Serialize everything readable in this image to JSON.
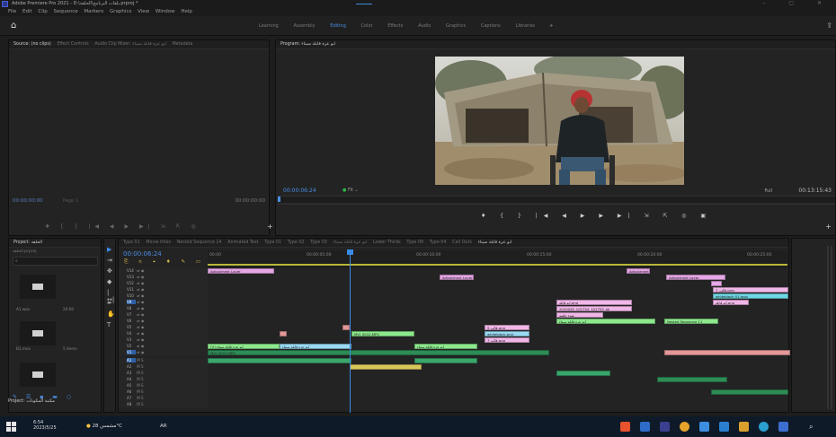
{
  "window": {
    "title": "Adobe Premiere Pro 2021 - D:\\بلقات البرنامج\\الحلقة.prproj *",
    "controls": "– ▢ ✕"
  },
  "menu": [
    "File",
    "Edit",
    "Clip",
    "Sequence",
    "Markers",
    "Graphics",
    "View",
    "Window",
    "Help"
  ],
  "workspaces": {
    "items": [
      "Learning",
      "Assembly",
      "Editing",
      "Color",
      "Effects",
      "Audio",
      "Graphics",
      "Captions",
      "Libraries"
    ],
    "active": "Editing",
    "more": "»"
  },
  "source_panel": {
    "tabs": [
      "Source: (no clips)",
      "Effect Controls",
      "Audio Clip Mixer: ابو عزة قابلة سيناء",
      "Metadata"
    ],
    "timecode_in": "00:00:00:00",
    "page": "Page 1",
    "timecode_out": "00:00:00:00"
  },
  "program_panel": {
    "tab": "Program: ابو عزة قابلة سيناء",
    "timecode": "00:00:06:24",
    "fit": "Fit",
    "quality": "Full",
    "duration": "00:13:15:43"
  },
  "project_panel": {
    "tab": "Project: الحلقة",
    "search_placeholder": "",
    "file": "الحلقة.prproj",
    "items": [
      {
        "name": "A1.wav",
        "meta": "24:00"
      },
      {
        "name": "B1.mov",
        "meta": "5 items"
      },
      {
        "name": "",
        "meta": ""
      }
    ],
    "bottom_tab": "Project: مكتبة المكونات"
  },
  "timeline": {
    "tabs": [
      "Type 01",
      "Movie titles",
      "Nested Sequence 14",
      "Animated Text",
      "Type 01",
      "Type 02",
      "Type 03",
      "ابو عزة قابلة سيناء",
      "Lower Thirds",
      "Type 08",
      "Type 04",
      "Call Outs",
      "ابو عزة قابلة سيناء"
    ],
    "active_tab": "ابو عزة قابلة سيناء",
    "timecode": "00:00:06:24",
    "ruler": [
      "00:00",
      "00:00:05:00",
      "00:00:10:00",
      "00:00:15:00",
      "00:00:20:00",
      "00:00:25:00"
    ],
    "video_tracks": [
      "V14",
      "V13",
      "V12",
      "V11",
      "V10",
      "V9",
      "V8",
      "V7",
      "V6",
      "V5",
      "V4",
      "V3",
      "V2",
      "V1"
    ],
    "audio_tracks": [
      "A1",
      "A2",
      "A3",
      "A4",
      "A5",
      "A6",
      "A7",
      "A8"
    ],
    "clips": {
      "adjustment": "Adjustment Layer",
      "lower_third": "ابو عزة قابلة سيناء",
      "main": "[V] ابو عزة قابلة سيناء",
      "arabic_title": "ابو عزة قابلة سيناء",
      "v1_clip": "MVI_0012.MP4",
      "png1": "7_قالب.png",
      "png2": "ابو قابلة.png",
      "file_long": "2020050_101754_101753_ok",
      "text_a": "ضوء خلفية",
      "white_black": "5 قالب.png",
      "white_black2": "whiteblack.png",
      "cyan_clip": "whiteblack 01.mov",
      "pink_small": "7 قالب.png",
      "nested": "Nested Sequence 11",
      "mvi": "MVI_0012.MP4"
    }
  },
  "taskbar": {
    "time": "6:54",
    "date": "2023/5/25",
    "weather": "مشمس 28°C",
    "language": "AR"
  }
}
